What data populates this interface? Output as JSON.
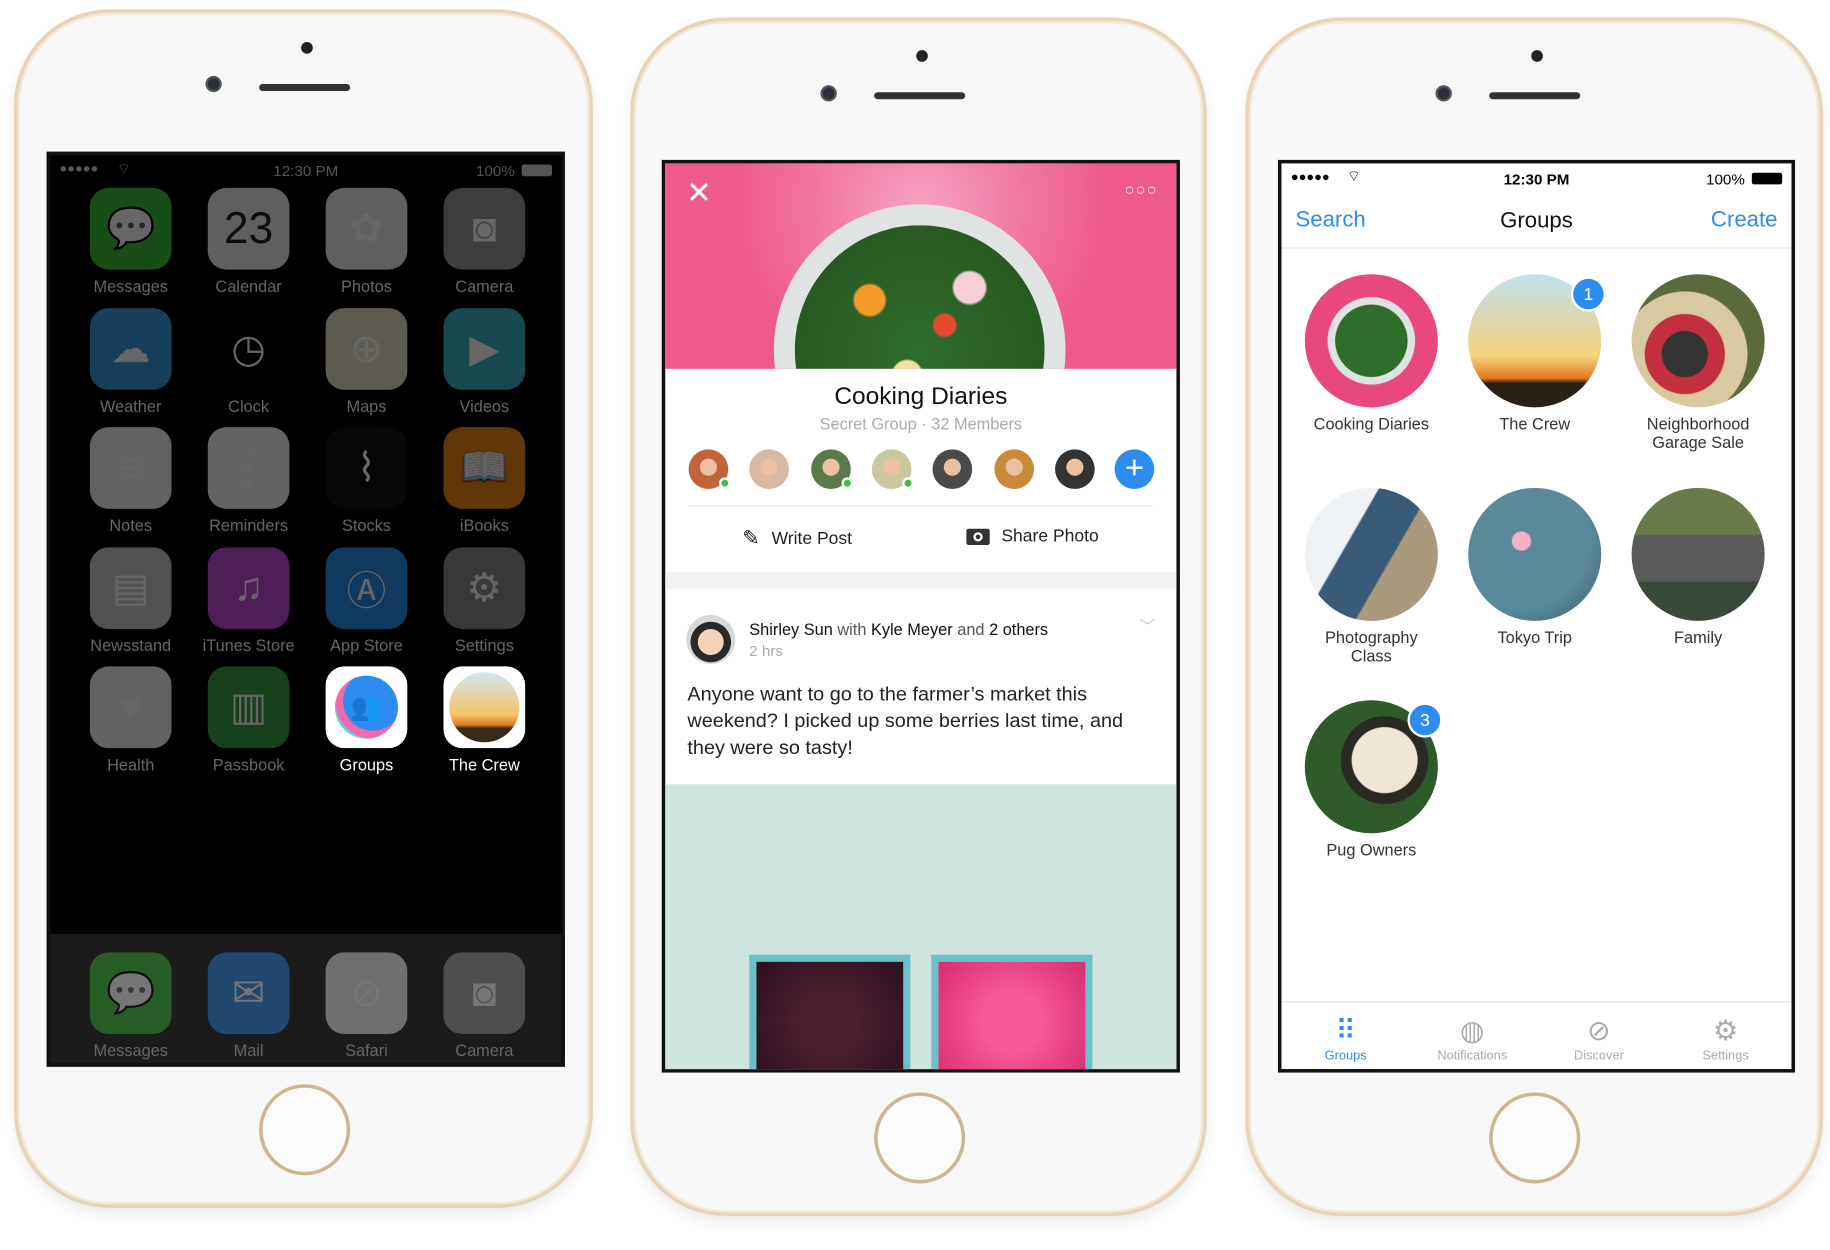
{
  "home_screen": {
    "status": {
      "carrier_signal": "●●●●●",
      "time": "12:30 PM",
      "battery": "100%"
    },
    "calendar_date": "23",
    "apps": [
      {
        "label": "Messages",
        "icon": "messages-icon",
        "color": "#3cc13c"
      },
      {
        "label": "Calendar",
        "icon": "calendar-icon",
        "color": "#eeeeee"
      },
      {
        "label": "Photos",
        "icon": "photos-icon",
        "color": "#eeeeee"
      },
      {
        "label": "Camera",
        "icon": "camera-icon",
        "color": "#9a9a9a"
      },
      {
        "label": "Weather",
        "icon": "weather-icon",
        "color": "#3a9ee0"
      },
      {
        "label": "Clock",
        "icon": "clock-icon",
        "color": "#000000"
      },
      {
        "label": "Maps",
        "icon": "maps-icon",
        "color": "#e8e2c8"
      },
      {
        "label": "Videos",
        "icon": "videos-icon",
        "color": "#3cb6c6"
      },
      {
        "label": "Notes",
        "icon": "notes-icon",
        "color": "#f4f4f4"
      },
      {
        "label": "Reminders",
        "icon": "reminders-icon",
        "color": "#f4f4f4"
      },
      {
        "label": "Stocks",
        "icon": "stocks-icon",
        "color": "#111111"
      },
      {
        "label": "iBooks",
        "icon": "ibooks-icon",
        "color": "#f08a10"
      },
      {
        "label": "Newsstand",
        "icon": "newsstand-icon",
        "color": "#cccccc"
      },
      {
        "label": "iTunes Store",
        "icon": "itunes-icon",
        "color": "#c44fd8"
      },
      {
        "label": "App Store",
        "icon": "app-store-icon",
        "color": "#2a8ef0"
      },
      {
        "label": "Settings",
        "icon": "settings-icon",
        "color": "#8e8e93"
      },
      {
        "label": "Health",
        "icon": "health-icon",
        "color": "#f4f4f4"
      },
      {
        "label": "Passbook",
        "icon": "passbook-icon",
        "color": "#3aa048"
      },
      {
        "label": "Groups",
        "icon": "groups-app-icon",
        "color": "#ffffff"
      },
      {
        "label": "The Crew",
        "icon": "the-crew-icon",
        "color": "#ffffff"
      }
    ],
    "dock": [
      {
        "label": "Messages",
        "icon": "messages-icon",
        "color": "#3cc13c"
      },
      {
        "label": "Mail",
        "icon": "mail-icon",
        "color": "#2a8ef0"
      },
      {
        "label": "Safari",
        "icon": "safari-icon",
        "color": "#eeeeee"
      },
      {
        "label": "Camera",
        "icon": "camera-icon",
        "color": "#9a9a9a"
      }
    ]
  },
  "group_screen": {
    "cover_color": "#ee5a8e",
    "title": "Cooking Diaries",
    "subtitle": "Secret Group · 32 Members",
    "members_online": [
      true,
      false,
      true,
      true,
      false,
      false,
      false
    ],
    "write_post": "Write Post",
    "share_photo": "Share Photo",
    "post": {
      "author": "Shirley Sun",
      "with": "with",
      "tagged": "Kyle Meyer",
      "and": "and",
      "others": "2 others",
      "time": "2 hrs",
      "body": "Anyone want to go to the farmer’s market this weekend? I picked up some berries last time, and they were so tasty!"
    }
  },
  "groups_list": {
    "status": {
      "carrier_signal": "●●●●●",
      "time": "12:30 PM",
      "battery": "100%"
    },
    "nav": {
      "left": "Search",
      "title": "Groups",
      "right": "Create"
    },
    "accent": "#2d8cf0",
    "groups": [
      {
        "name": "Cooking Diaries",
        "badge": null
      },
      {
        "name": "The Crew",
        "badge": "1"
      },
      {
        "name": "Neighborhood Garage Sale",
        "badge": null
      },
      {
        "name": "Photography Class",
        "badge": null
      },
      {
        "name": "Tokyo Trip",
        "badge": null
      },
      {
        "name": "Family",
        "badge": null
      },
      {
        "name": "Pug Owners",
        "badge": "3"
      }
    ],
    "tabs": [
      {
        "label": "Groups",
        "active": true
      },
      {
        "label": "Notifications",
        "active": false
      },
      {
        "label": "Discover",
        "active": false
      },
      {
        "label": "Settings",
        "active": false
      }
    ]
  }
}
